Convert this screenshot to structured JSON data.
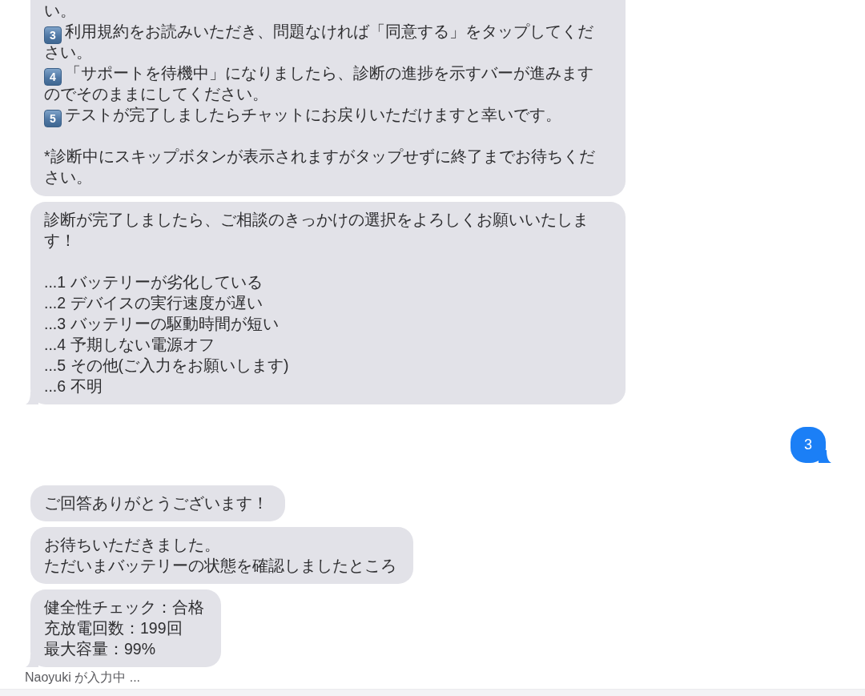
{
  "messages": [
    {
      "kind": "received",
      "cut_top": true,
      "tail": false,
      "blocks": [
        [
          {
            "text": "い。"
          },
          {
            "step": "3",
            "text": "利用規約をお読みいただき、問題なければ「同意する」をタップしてください。"
          },
          {
            "step": "4",
            "text": "「サポートを待機中」になりましたら、診断の進捗を示すバーが進みますのでそのままにしてください。"
          },
          {
            "step": "5",
            "text": "テストが完了しましたらチャットにお戻りいただけますと幸いです。"
          }
        ],
        [
          {
            "text": "*診断中にスキップボタンが表示されますがタップせずに終了までお待ちください。"
          }
        ]
      ]
    },
    {
      "kind": "received",
      "cut_top": false,
      "tail": true,
      "blocks": [
        [
          {
            "text": "診断が完了しましたら、ご相談のきっかけの選択をよろしくお願いいたします！"
          }
        ],
        [
          {
            "text": "...1 バッテリーが劣化している"
          },
          {
            "text": "...2 デバイスの実行速度が遅い"
          },
          {
            "text": "...3 バッテリーの駆動時間が短い"
          },
          {
            "text": "...4 予期しない電源オフ"
          },
          {
            "text": "...5 その他(ご入力をお願いします)"
          },
          {
            "text": "...6 不明"
          }
        ]
      ]
    },
    {
      "kind": "sent",
      "cut_top": false,
      "tail": true,
      "blocks": [
        [
          {
            "text": "3"
          }
        ]
      ]
    },
    {
      "kind": "received",
      "cut_top": false,
      "tail": false,
      "blocks": [
        [
          {
            "text": "ご回答ありがとうございます！"
          }
        ]
      ]
    },
    {
      "kind": "received",
      "cut_top": false,
      "tail": false,
      "blocks": [
        [
          {
            "text": "お待ちいただきました。"
          },
          {
            "text": "ただいまバッテリーの状態を確認しましたところ"
          }
        ]
      ]
    },
    {
      "kind": "received",
      "cut_top": false,
      "tail": true,
      "blocks": [
        [
          {
            "text": "健全性チェック：合格"
          },
          {
            "text": "充放電回数：199回"
          },
          {
            "text": "最大容量：99%"
          }
        ]
      ]
    }
  ],
  "typing_indicator": {
    "text": "Naoyuki が入力中 ..."
  }
}
